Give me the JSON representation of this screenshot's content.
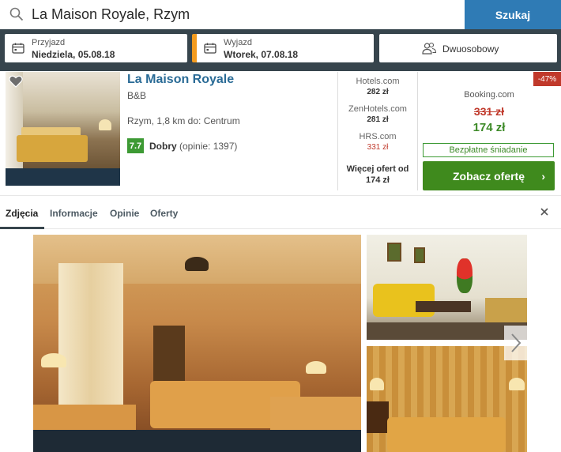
{
  "search": {
    "query": "La Maison Royale, Rzym",
    "button_label": "Szukaj"
  },
  "dates": {
    "checkin_label": "Przyjazd",
    "checkin_value": "Niedziela, 05.08.18",
    "checkout_label": "Wyjazd",
    "checkout_value": "Wtorek, 07.08.18"
  },
  "room": {
    "value": "Dwuosobowy"
  },
  "hotel": {
    "name": "La Maison Royale",
    "type": "B&B",
    "location": "Rzym, 1,8 km do: Centrum",
    "rating_score": "7.7",
    "rating_word": "Dobry",
    "rating_count": "(opinie: 1397)"
  },
  "deals": [
    {
      "site": "Hotels.com",
      "price": "282 zł"
    },
    {
      "site": "ZenHotels.com",
      "price": "281 zł"
    },
    {
      "site": "HRS.com",
      "price": "331 zł"
    }
  ],
  "more_offers": {
    "line1": "Więcej ofert od",
    "line2": "174 zł"
  },
  "best_offer": {
    "discount": "-47%",
    "provider": "Booking.com",
    "old_price": "331 zł",
    "new_price": "174 zł",
    "perk": "Bezpłatne śniadanie",
    "button_label": "Zobacz ofertę",
    "button_chevron": "›"
  },
  "tabs": [
    {
      "label": "Zdjęcia"
    },
    {
      "label": "Informacje"
    },
    {
      "label": "Opinie"
    },
    {
      "label": "Oferty"
    }
  ],
  "gallery": {
    "next_arrow": "›"
  },
  "colors": {
    "header_bg": "#37454d",
    "search_button": "#2f7bb5",
    "accent_orange": "#f39b1e",
    "title_blue": "#2a6b96",
    "rating_green": "#3d9a34",
    "cta_green": "#3f8a1d",
    "discount_red": "#c0392b"
  },
  "icons": [
    "search-icon",
    "calendar-icon",
    "people-icon",
    "heart-icon",
    "chevron-right-icon",
    "close-icon"
  ]
}
